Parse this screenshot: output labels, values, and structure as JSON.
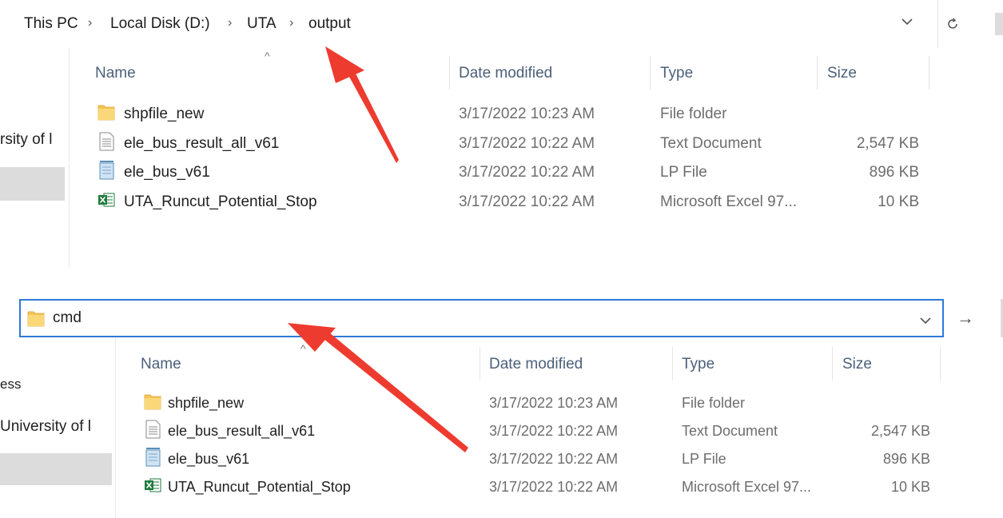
{
  "top_window": {
    "breadcrumb": [
      "This PC",
      "Local Disk (D:)",
      "UTA",
      "output"
    ],
    "side_label": "rsity of l",
    "columns": {
      "name": "Name",
      "date": "Date modified",
      "type": "Type",
      "size": "Size"
    },
    "files": [
      {
        "icon": "folder-icon",
        "name": "shpfile_new",
        "date": "3/17/2022 10:23 AM",
        "type": "File folder",
        "size": ""
      },
      {
        "icon": "text-document-icon",
        "name": "ele_bus_result_all_v61",
        "date": "3/17/2022 10:22 AM",
        "type": "Text Document",
        "size": "2,547 KB"
      },
      {
        "icon": "lp-file-icon",
        "name": "ele_bus_v61",
        "date": "3/17/2022 10:22 AM",
        "type": "LP File",
        "size": "896 KB"
      },
      {
        "icon": "excel-icon",
        "name": "UTA_Runcut_Potential_Stop",
        "date": "3/17/2022 10:22 AM",
        "type": "Microsoft Excel 97...",
        "size": "10 KB"
      }
    ]
  },
  "bottom_window": {
    "address_value": "cmd",
    "side_labels": [
      "ess",
      "University of l"
    ],
    "columns": {
      "name": "Name",
      "date": "Date modified",
      "type": "Type",
      "size": "Size"
    },
    "files": [
      {
        "icon": "folder-icon",
        "name": "shpfile_new",
        "date": "3/17/2022 10:23 AM",
        "type": "File folder",
        "size": ""
      },
      {
        "icon": "text-document-icon",
        "name": "ele_bus_result_all_v61",
        "date": "3/17/2022 10:22 AM",
        "type": "Text Document",
        "size": "2,547 KB"
      },
      {
        "icon": "lp-file-icon",
        "name": "ele_bus_v61",
        "date": "3/17/2022 10:22 AM",
        "type": "LP File",
        "size": "896 KB"
      },
      {
        "icon": "excel-icon",
        "name": "UTA_Runcut_Potential_Stop",
        "date": "3/17/2022 10:22 AM",
        "type": "Microsoft Excel 97...",
        "size": "10 KB"
      }
    ]
  },
  "colors": {
    "arrow": "#ee3b2f",
    "focus_border": "#2f7ad8",
    "folder": "#f5c453",
    "excel": "#1f7a3e",
    "header_text": "#4c607a"
  }
}
